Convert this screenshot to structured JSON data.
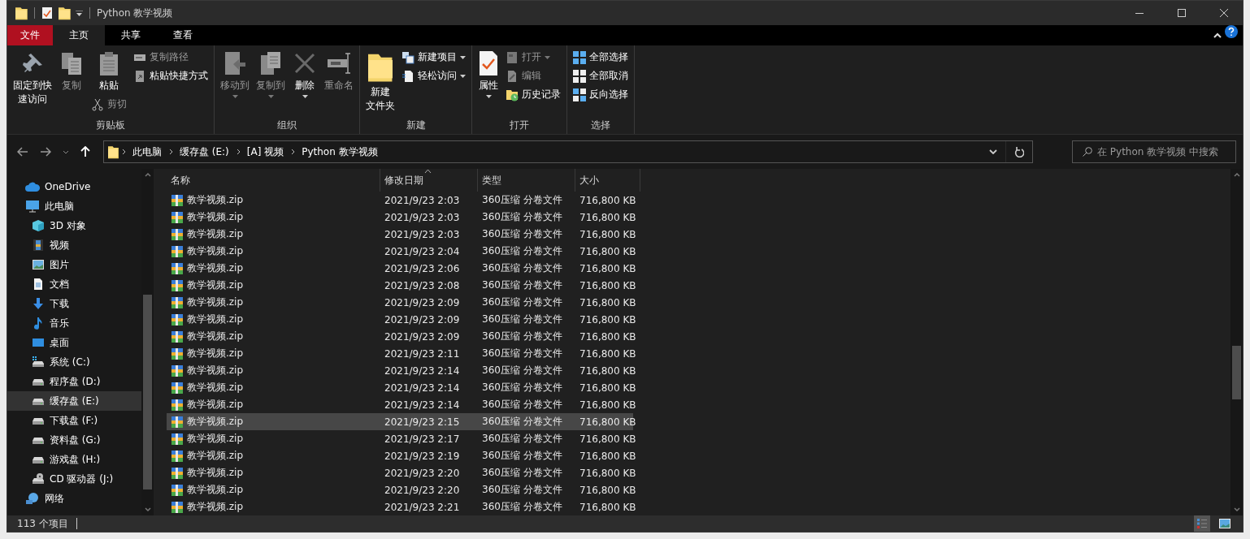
{
  "window": {
    "title": "Python 教学视频"
  },
  "tabs": [
    {
      "label": "文件",
      "kind": "file",
      "selected": false
    },
    {
      "label": "主页",
      "kind": "tab",
      "selected": true
    },
    {
      "label": "共享",
      "kind": "tab",
      "selected": false
    },
    {
      "label": "查看",
      "kind": "tab",
      "selected": false
    }
  ],
  "ribbon": {
    "groups": [
      {
        "label": "剪贴板",
        "columns": [
          [
            {
              "lines": [
                "固定到快",
                "速访问"
              ],
              "kind": "large",
              "disabled": false,
              "dropdown": false
            }
          ],
          [
            {
              "label": "复制",
              "kind": "large",
              "disabled": true,
              "dropdown": false
            }
          ],
          [
            {
              "label": "粘贴",
              "kind": "large",
              "disabled": false,
              "dropdown": false
            },
            {
              "label": "剪切",
              "kind": "small",
              "disabled": true,
              "dropdown": false
            }
          ],
          [
            {
              "label": "复制路径",
              "kind": "small",
              "disabled": true,
              "dropdown": false
            },
            {
              "label": "粘贴快捷方式",
              "kind": "small",
              "disabled": false,
              "dropdown": false
            }
          ]
        ]
      },
      {
        "label": "组织",
        "columns": [
          [
            {
              "label": "移动到",
              "kind": "large",
              "disabled": true,
              "dropdown": true
            }
          ],
          [
            {
              "label": "复制到",
              "kind": "large",
              "disabled": true,
              "dropdown": true
            }
          ],
          [
            {
              "label": "删除",
              "kind": "large",
              "disabled": false,
              "dropdown": true
            }
          ],
          [
            {
              "label": "重命名",
              "kind": "large",
              "disabled": true,
              "dropdown": false
            }
          ]
        ]
      },
      {
        "label": "新建",
        "columns": [
          [
            {
              "lines": [
                "新建",
                "文件夹"
              ],
              "kind": "large",
              "disabled": false,
              "dropdown": false
            }
          ],
          [
            {
              "label": "新建项目",
              "kind": "small",
              "disabled": false,
              "dropdown": true
            },
            {
              "label": "轻松访问",
              "kind": "small",
              "disabled": false,
              "dropdown": true
            }
          ]
        ]
      },
      {
        "label": "打开",
        "columns": [
          [
            {
              "label": "属性",
              "kind": "large",
              "disabled": false,
              "dropdown": true
            }
          ],
          [
            {
              "label": "打开",
              "kind": "small",
              "disabled": true,
              "dropdown": true
            },
            {
              "label": "编辑",
              "kind": "small",
              "disabled": true,
              "dropdown": false
            },
            {
              "label": "历史记录",
              "kind": "small",
              "disabled": false,
              "dropdown": false
            }
          ]
        ]
      },
      {
        "label": "选择",
        "columns": [
          [
            {
              "label": "全部选择",
              "kind": "small",
              "disabled": false,
              "dropdown": false
            },
            {
              "label": "全部取消",
              "kind": "small",
              "disabled": false,
              "dropdown": false
            },
            {
              "label": "反向选择",
              "kind": "small",
              "disabled": false,
              "dropdown": false
            }
          ]
        ]
      }
    ]
  },
  "address": {
    "crumbs": [
      "此电脑",
      "缓存盘 (E:)",
      "[A] 视频",
      "Python 教学视频"
    ]
  },
  "search": {
    "placeholder": "在 Python 教学视频 中搜索"
  },
  "sidebar": {
    "items": [
      {
        "label": "OneDrive",
        "selected": false
      },
      {
        "label": "此电脑",
        "selected": false,
        "children": [
          {
            "label": "3D 对象",
            "selected": false
          },
          {
            "label": "视频",
            "selected": false
          },
          {
            "label": "图片",
            "selected": false
          },
          {
            "label": "文档",
            "selected": false
          },
          {
            "label": "下载",
            "selected": false
          },
          {
            "label": "音乐",
            "selected": false
          },
          {
            "label": "桌面",
            "selected": false
          },
          {
            "label": "系统 (C:)",
            "selected": false
          },
          {
            "label": "程序盘 (D:)",
            "selected": false
          },
          {
            "label": "缓存盘 (E:)",
            "selected": true
          },
          {
            "label": "下载盘 (F:)",
            "selected": false
          },
          {
            "label": "资料盘 (G:)",
            "selected": false
          },
          {
            "label": "游戏盘 (H:)",
            "selected": false
          },
          {
            "label": "CD 驱动器 (J:)",
            "selected": false
          }
        ]
      },
      {
        "label": "网络",
        "selected": false
      }
    ]
  },
  "table": {
    "columns": [
      {
        "label": "名称",
        "sorted": false
      },
      {
        "label": "修改日期",
        "sorted": true
      },
      {
        "label": "类型",
        "sorted": false
      },
      {
        "label": "大小",
        "sorted": false
      }
    ],
    "rows": [
      {
        "name": "教学视频.zip",
        "date": "2021/9/23 2:03",
        "type": "360压缩 分卷文件",
        "size": "716,800 KB",
        "selected": false
      },
      {
        "name": "教学视频.zip",
        "date": "2021/9/23 2:03",
        "type": "360压缩 分卷文件",
        "size": "716,800 KB",
        "selected": false
      },
      {
        "name": "教学视频.zip",
        "date": "2021/9/23 2:03",
        "type": "360压缩 分卷文件",
        "size": "716,800 KB",
        "selected": false
      },
      {
        "name": "教学视频.zip",
        "date": "2021/9/23 2:04",
        "type": "360压缩 分卷文件",
        "size": "716,800 KB",
        "selected": false
      },
      {
        "name": "教学视频.zip",
        "date": "2021/9/23 2:06",
        "type": "360压缩 分卷文件",
        "size": "716,800 KB",
        "selected": false
      },
      {
        "name": "教学视频.zip",
        "date": "2021/9/23 2:08",
        "type": "360压缩 分卷文件",
        "size": "716,800 KB",
        "selected": false
      },
      {
        "name": "教学视频.zip",
        "date": "2021/9/23 2:09",
        "type": "360压缩 分卷文件",
        "size": "716,800 KB",
        "selected": false
      },
      {
        "name": "教学视频.zip",
        "date": "2021/9/23 2:09",
        "type": "360压缩 分卷文件",
        "size": "716,800 KB",
        "selected": false
      },
      {
        "name": "教学视频.zip",
        "date": "2021/9/23 2:09",
        "type": "360压缩 分卷文件",
        "size": "716,800 KB",
        "selected": false
      },
      {
        "name": "教学视频.zip",
        "date": "2021/9/23 2:11",
        "type": "360压缩 分卷文件",
        "size": "716,800 KB",
        "selected": false
      },
      {
        "name": "教学视频.zip",
        "date": "2021/9/23 2:14",
        "type": "360压缩 分卷文件",
        "size": "716,800 KB",
        "selected": false
      },
      {
        "name": "教学视频.zip",
        "date": "2021/9/23 2:14",
        "type": "360压缩 分卷文件",
        "size": "716,800 KB",
        "selected": false
      },
      {
        "name": "教学视频.zip",
        "date": "2021/9/23 2:14",
        "type": "360压缩 分卷文件",
        "size": "716,800 KB",
        "selected": false
      },
      {
        "name": "教学视频.zip",
        "date": "2021/9/23 2:15",
        "type": "360压缩 分卷文件",
        "size": "716,800 KB",
        "selected": true
      },
      {
        "name": "教学视频.zip",
        "date": "2021/9/23 2:17",
        "type": "360压缩 分卷文件",
        "size": "716,800 KB",
        "selected": false
      },
      {
        "name": "教学视频.zip",
        "date": "2021/9/23 2:19",
        "type": "360压缩 分卷文件",
        "size": "716,800 KB",
        "selected": false
      },
      {
        "name": "教学视频.zip",
        "date": "2021/9/23 2:20",
        "type": "360压缩 分卷文件",
        "size": "716,800 KB",
        "selected": false
      },
      {
        "name": "教学视频.zip",
        "date": "2021/9/23 2:20",
        "type": "360压缩 分卷文件",
        "size": "716,800 KB",
        "selected": false
      },
      {
        "name": "教学视频.zip",
        "date": "2021/9/23 2:21",
        "type": "360压缩 分卷文件",
        "size": "716,800 KB",
        "selected": false
      }
    ]
  },
  "status_bar": {
    "count": "113 个项目"
  }
}
